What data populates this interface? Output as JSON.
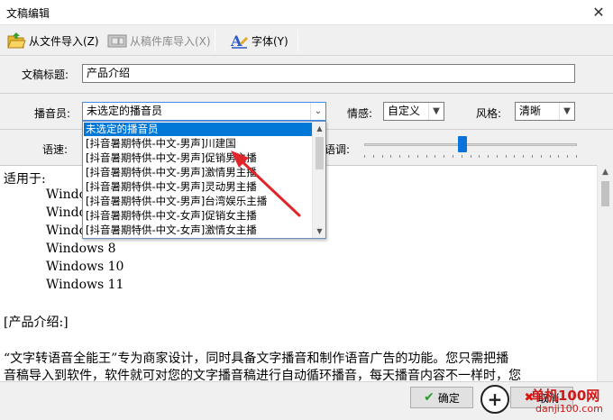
{
  "window": {
    "title": "文稿编辑"
  },
  "toolbar": {
    "import_file_label": "从文件导入(Z)",
    "import_library_label": "从稿件库导入(X)",
    "font_label": "字体(Y)"
  },
  "form": {
    "title_label": "文稿标题:",
    "title_value": "产品介绍",
    "announcer_label": "播音员:",
    "announcer_selected": "未选定的播音员",
    "emotion_label": "情感:",
    "emotion_value": "自定义",
    "style_label": "风格:",
    "style_value": "清晰",
    "speed_label": "语速:",
    "pitch_label": "语调:"
  },
  "dropdown": {
    "items": [
      "未选定的播音员",
      "[抖音暑期特供-中文-男声]川建国",
      "[抖音暑期特供-中文-男声]促销男主播",
      "[抖音暑期特供-中文-男声]激情男主播",
      "[抖音暑期特供-中文-男声]灵动男主播",
      "[抖音暑期特供-中文-男声]台湾娱乐主播",
      "[抖音暑期特供-中文-女声]促销女主播",
      "[抖音暑期特供-中文-女声]激情女主播"
    ],
    "selected_index": 0
  },
  "content": {
    "lines": [
      "适用于:",
      "Windows",
      "Windows",
      "Windows",
      "Windows 8",
      "Windows 10",
      "Windows 11",
      "",
      "[产品介绍:]",
      "",
      "“文字转语音全能王”专为商家设计，同时具备文字播音和制作语音广告的功能。您只需把播",
      "音稿导入到软件，软件就可对您的文字播音稿进行自动循环播音，每天播音内容不一样时，您"
    ]
  },
  "footer": {
    "ok_label": "确定",
    "cancel_label": "取消"
  },
  "watermark": {
    "brand": "单机100网",
    "url": "danji100.com"
  },
  "colors": {
    "selection": "#0078d7",
    "arrow": "#e0262a",
    "accent": "#0a74da"
  },
  "slider": {
    "speed_level": 0.46
  }
}
